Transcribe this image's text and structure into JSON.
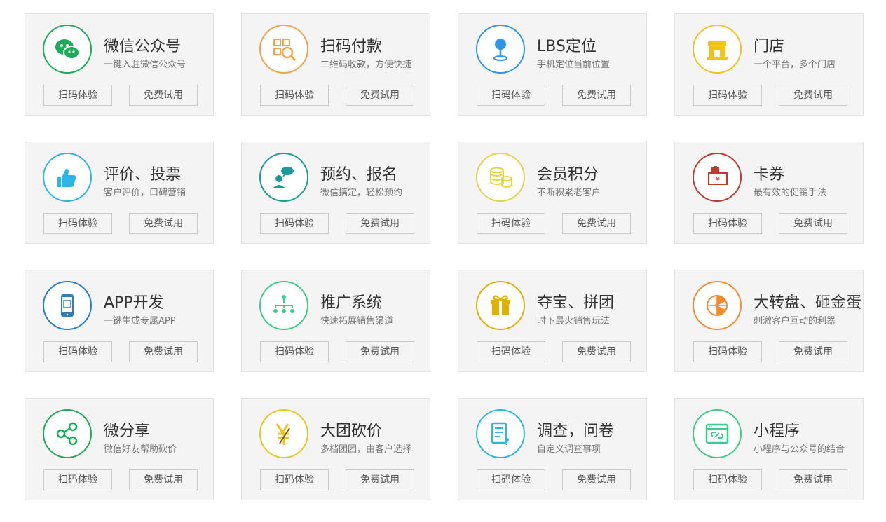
{
  "features": [
    {
      "title": "微信公众号",
      "desc": "一键入驻微信公众号",
      "icon": "wechat-icon",
      "color": "#1aad5a",
      "scan_label": "扫码体验",
      "trial_label": "免费试用"
    },
    {
      "title": "扫码付款",
      "desc": "二维码收款，方便快捷",
      "icon": "qr-scan-icon",
      "color": "#f5a14a",
      "scan_label": "扫码体验",
      "trial_label": "免费试用"
    },
    {
      "title": "LBS定位",
      "desc": "手机定位当前位置",
      "icon": "location-pin-icon",
      "color": "#2e95e8",
      "scan_label": "扫码体验",
      "trial_label": "免费试用"
    },
    {
      "title": "门店",
      "desc": "一个平台，多个门店",
      "icon": "store-icon",
      "color": "#f0c419",
      "scan_label": "扫码体验",
      "trial_label": "免费试用"
    },
    {
      "title": "评价、投票",
      "desc": "客户评价，口碑营销",
      "icon": "thumbs-up-icon",
      "color": "#2cb6e8",
      "scan_label": "扫码体验",
      "trial_label": "免费试用"
    },
    {
      "title": "预约、报名",
      "desc": "微信搞定，轻松预约",
      "icon": "appointment-icon",
      "color": "#1a9b9b",
      "scan_label": "扫码体验",
      "trial_label": "免费试用"
    },
    {
      "title": "会员积分",
      "desc": "不断积累老客户",
      "icon": "coins-icon",
      "color": "#e8d24a",
      "scan_label": "扫码体验",
      "trial_label": "免费试用"
    },
    {
      "title": "卡券",
      "desc": "最有效的促销手法",
      "icon": "coupon-icon",
      "color": "#c0392b",
      "scan_label": "扫码体验",
      "trial_label": "免费试用"
    },
    {
      "title": "APP开发",
      "desc": "一键生成专属APP",
      "icon": "mobile-app-icon",
      "color": "#2a7fc9",
      "scan_label": "扫码体验",
      "trial_label": "免费试用"
    },
    {
      "title": "推广系统",
      "desc": "快速拓展销售渠道",
      "icon": "network-icon",
      "color": "#3ccc8a",
      "scan_label": "扫码体验",
      "trial_label": "免费试用"
    },
    {
      "title": "夺宝、拼团",
      "desc": "时下最火销售玩法",
      "icon": "gift-icon",
      "color": "#e2b000",
      "scan_label": "扫码体验",
      "trial_label": "免费试用"
    },
    {
      "title": "大转盘、砸金蛋",
      "desc": "刺激客户互动的利器",
      "icon": "wheel-icon",
      "color": "#f28a2e",
      "scan_label": "扫码体验",
      "trial_label": "免费试用"
    },
    {
      "title": "微分享",
      "desc": "微信好友帮助砍价",
      "icon": "share-icon",
      "color": "#1aad5a",
      "scan_label": "扫码体验",
      "trial_label": "免费试用"
    },
    {
      "title": "大团砍价",
      "desc": "多档团团，由客户选择",
      "icon": "bargain-icon",
      "color": "#f0c419",
      "scan_label": "扫码体验",
      "trial_label": "免费试用"
    },
    {
      "title": "调查，问卷",
      "desc": "自定义调查事项",
      "icon": "survey-icon",
      "color": "#2cb6e8",
      "scan_label": "扫码体验",
      "trial_label": "免费试用"
    },
    {
      "title": "小程序",
      "desc": "小程序与公众号的结合",
      "icon": "mini-program-icon",
      "color": "#3ccc8a",
      "scan_label": "扫码体验",
      "trial_label": "免费试用"
    }
  ]
}
